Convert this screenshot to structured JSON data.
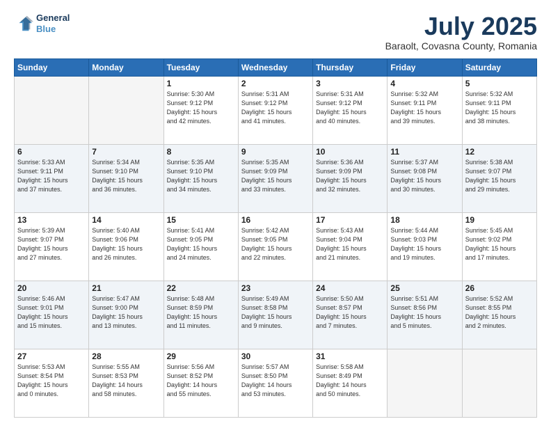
{
  "header": {
    "logo_line1": "General",
    "logo_line2": "Blue",
    "title": "July 2025",
    "subtitle": "Baraolt, Covasna County, Romania"
  },
  "weekdays": [
    "Sunday",
    "Monday",
    "Tuesday",
    "Wednesday",
    "Thursday",
    "Friday",
    "Saturday"
  ],
  "weeks": [
    [
      {
        "day": "",
        "info": ""
      },
      {
        "day": "",
        "info": ""
      },
      {
        "day": "1",
        "info": "Sunrise: 5:30 AM\nSunset: 9:12 PM\nDaylight: 15 hours\nand 42 minutes."
      },
      {
        "day": "2",
        "info": "Sunrise: 5:31 AM\nSunset: 9:12 PM\nDaylight: 15 hours\nand 41 minutes."
      },
      {
        "day": "3",
        "info": "Sunrise: 5:31 AM\nSunset: 9:12 PM\nDaylight: 15 hours\nand 40 minutes."
      },
      {
        "day": "4",
        "info": "Sunrise: 5:32 AM\nSunset: 9:11 PM\nDaylight: 15 hours\nand 39 minutes."
      },
      {
        "day": "5",
        "info": "Sunrise: 5:32 AM\nSunset: 9:11 PM\nDaylight: 15 hours\nand 38 minutes."
      }
    ],
    [
      {
        "day": "6",
        "info": "Sunrise: 5:33 AM\nSunset: 9:11 PM\nDaylight: 15 hours\nand 37 minutes."
      },
      {
        "day": "7",
        "info": "Sunrise: 5:34 AM\nSunset: 9:10 PM\nDaylight: 15 hours\nand 36 minutes."
      },
      {
        "day": "8",
        "info": "Sunrise: 5:35 AM\nSunset: 9:10 PM\nDaylight: 15 hours\nand 34 minutes."
      },
      {
        "day": "9",
        "info": "Sunrise: 5:35 AM\nSunset: 9:09 PM\nDaylight: 15 hours\nand 33 minutes."
      },
      {
        "day": "10",
        "info": "Sunrise: 5:36 AM\nSunset: 9:09 PM\nDaylight: 15 hours\nand 32 minutes."
      },
      {
        "day": "11",
        "info": "Sunrise: 5:37 AM\nSunset: 9:08 PM\nDaylight: 15 hours\nand 30 minutes."
      },
      {
        "day": "12",
        "info": "Sunrise: 5:38 AM\nSunset: 9:07 PM\nDaylight: 15 hours\nand 29 minutes."
      }
    ],
    [
      {
        "day": "13",
        "info": "Sunrise: 5:39 AM\nSunset: 9:07 PM\nDaylight: 15 hours\nand 27 minutes."
      },
      {
        "day": "14",
        "info": "Sunrise: 5:40 AM\nSunset: 9:06 PM\nDaylight: 15 hours\nand 26 minutes."
      },
      {
        "day": "15",
        "info": "Sunrise: 5:41 AM\nSunset: 9:05 PM\nDaylight: 15 hours\nand 24 minutes."
      },
      {
        "day": "16",
        "info": "Sunrise: 5:42 AM\nSunset: 9:05 PM\nDaylight: 15 hours\nand 22 minutes."
      },
      {
        "day": "17",
        "info": "Sunrise: 5:43 AM\nSunset: 9:04 PM\nDaylight: 15 hours\nand 21 minutes."
      },
      {
        "day": "18",
        "info": "Sunrise: 5:44 AM\nSunset: 9:03 PM\nDaylight: 15 hours\nand 19 minutes."
      },
      {
        "day": "19",
        "info": "Sunrise: 5:45 AM\nSunset: 9:02 PM\nDaylight: 15 hours\nand 17 minutes."
      }
    ],
    [
      {
        "day": "20",
        "info": "Sunrise: 5:46 AM\nSunset: 9:01 PM\nDaylight: 15 hours\nand 15 minutes."
      },
      {
        "day": "21",
        "info": "Sunrise: 5:47 AM\nSunset: 9:00 PM\nDaylight: 15 hours\nand 13 minutes."
      },
      {
        "day": "22",
        "info": "Sunrise: 5:48 AM\nSunset: 8:59 PM\nDaylight: 15 hours\nand 11 minutes."
      },
      {
        "day": "23",
        "info": "Sunrise: 5:49 AM\nSunset: 8:58 PM\nDaylight: 15 hours\nand 9 minutes."
      },
      {
        "day": "24",
        "info": "Sunrise: 5:50 AM\nSunset: 8:57 PM\nDaylight: 15 hours\nand 7 minutes."
      },
      {
        "day": "25",
        "info": "Sunrise: 5:51 AM\nSunset: 8:56 PM\nDaylight: 15 hours\nand 5 minutes."
      },
      {
        "day": "26",
        "info": "Sunrise: 5:52 AM\nSunset: 8:55 PM\nDaylight: 15 hours\nand 2 minutes."
      }
    ],
    [
      {
        "day": "27",
        "info": "Sunrise: 5:53 AM\nSunset: 8:54 PM\nDaylight: 15 hours\nand 0 minutes."
      },
      {
        "day": "28",
        "info": "Sunrise: 5:55 AM\nSunset: 8:53 PM\nDaylight: 14 hours\nand 58 minutes."
      },
      {
        "day": "29",
        "info": "Sunrise: 5:56 AM\nSunset: 8:52 PM\nDaylight: 14 hours\nand 55 minutes."
      },
      {
        "day": "30",
        "info": "Sunrise: 5:57 AM\nSunset: 8:50 PM\nDaylight: 14 hours\nand 53 minutes."
      },
      {
        "day": "31",
        "info": "Sunrise: 5:58 AM\nSunset: 8:49 PM\nDaylight: 14 hours\nand 50 minutes."
      },
      {
        "day": "",
        "info": ""
      },
      {
        "day": "",
        "info": ""
      }
    ]
  ]
}
